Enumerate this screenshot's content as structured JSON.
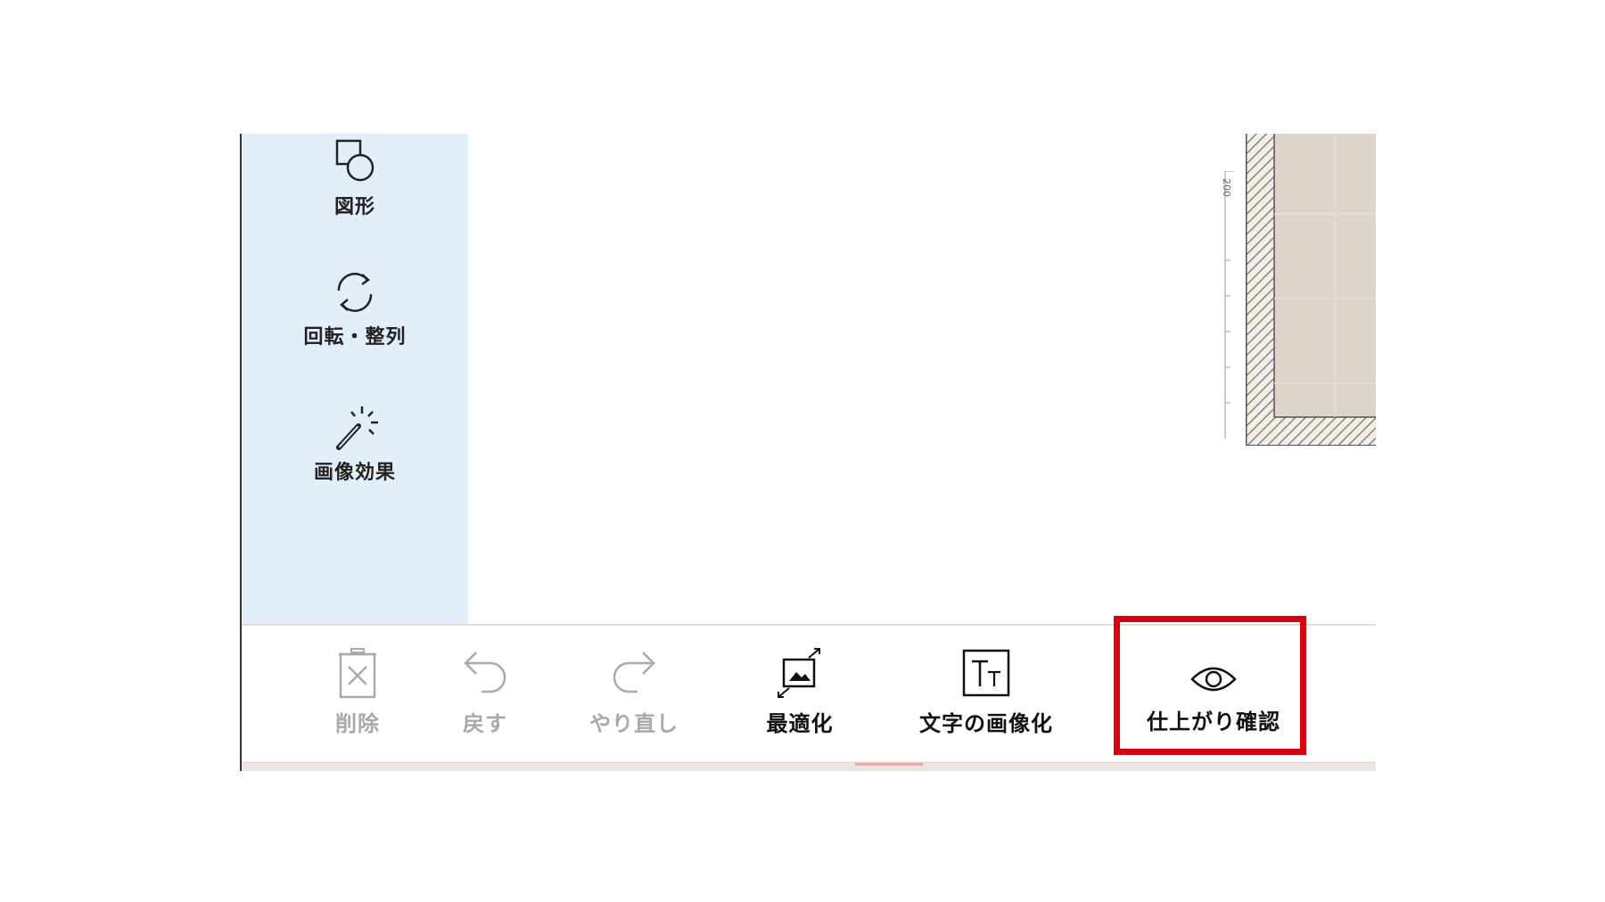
{
  "side_panel": {
    "items": [
      {
        "label": "図形",
        "icon": "shapes-icon"
      },
      {
        "label": "回転・整列",
        "icon": "rotate-icon"
      },
      {
        "label": "画像効果",
        "icon": "magic-wand-icon"
      }
    ]
  },
  "canvas": {
    "ruler_label": "200",
    "hatch_color": "#8c7f73",
    "fill_color": "#ddd4cb"
  },
  "toolbar": {
    "items": [
      {
        "label": "削除",
        "icon": "trash-delete-icon",
        "enabled": false
      },
      {
        "label": "戻す",
        "icon": "undo-icon",
        "enabled": false
      },
      {
        "label": "やり直し",
        "icon": "redo-icon",
        "enabled": false
      },
      {
        "label": "最適化",
        "icon": "image-fit-icon",
        "enabled": true
      },
      {
        "label": "文字の画像化",
        "icon": "text-to-image-icon",
        "enabled": true
      },
      {
        "label": "仕上がり確認",
        "icon": "eye-icon",
        "enabled": true
      }
    ]
  },
  "colors": {
    "panel_bg": "#e2eefa",
    "highlight": "#d7000f",
    "disabled_text": "#a9a9a9"
  }
}
